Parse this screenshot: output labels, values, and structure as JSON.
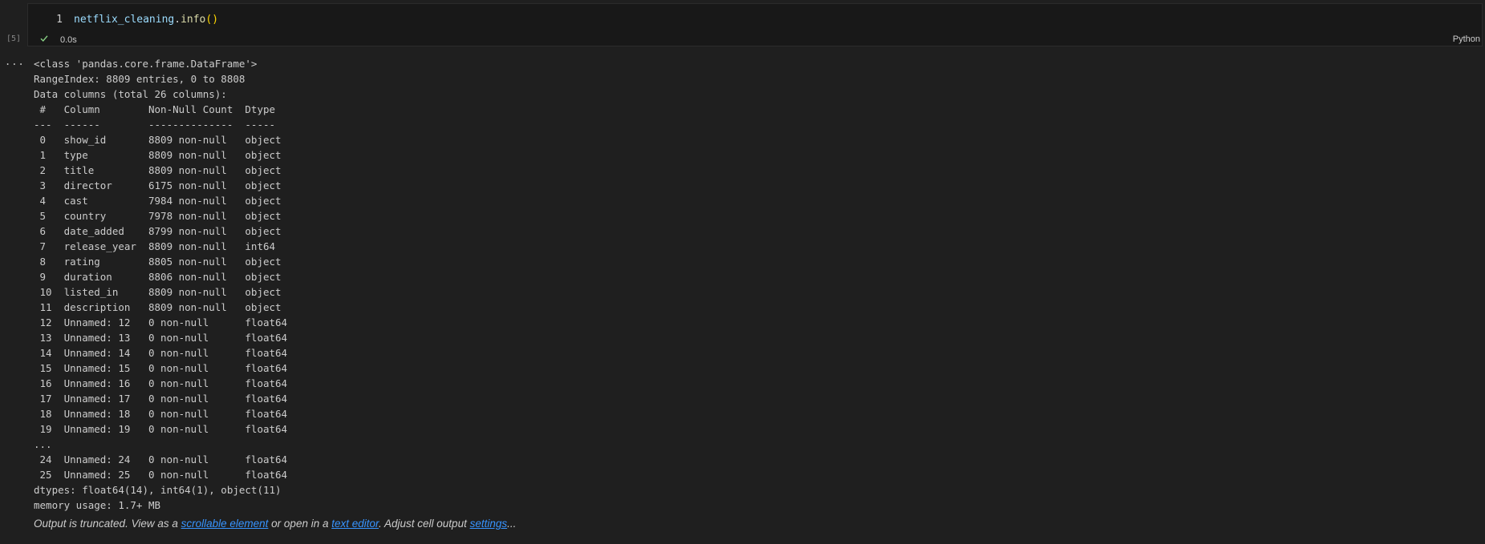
{
  "cell": {
    "execution_count": "[5]",
    "line_number": "1",
    "code": {
      "var": "netflix_cleaning",
      "dot": ".",
      "fn": "info",
      "parens": "()"
    },
    "status_icon": "check-icon",
    "duration": "0.0s",
    "language": "Python"
  },
  "output": {
    "menu_label": "...",
    "lines": [
      "<class 'pandas.core.frame.DataFrame'>",
      "RangeIndex: 8809 entries, 0 to 8808",
      "Data columns (total 26 columns):",
      " #   Column        Non-Null Count  Dtype  ",
      "---  ------        --------------  -----  ",
      " 0   show_id       8809 non-null   object ",
      " 1   type          8809 non-null   object ",
      " 2   title         8809 non-null   object ",
      " 3   director      6175 non-null   object ",
      " 4   cast          7984 non-null   object ",
      " 5   country       7978 non-null   object ",
      " 6   date_added    8799 non-null   object ",
      " 7   release_year  8809 non-null   int64  ",
      " 8   rating        8805 non-null   object ",
      " 9   duration      8806 non-null   object ",
      " 10  listed_in     8809 non-null   object ",
      " 11  description   8809 non-null   object ",
      " 12  Unnamed: 12   0 non-null      float64",
      " 13  Unnamed: 13   0 non-null      float64",
      " 14  Unnamed: 14   0 non-null      float64",
      " 15  Unnamed: 15   0 non-null      float64",
      " 16  Unnamed: 16   0 non-null      float64",
      " 17  Unnamed: 17   0 non-null      float64",
      " 18  Unnamed: 18   0 non-null      float64",
      " 19  Unnamed: 19   0 non-null      float64",
      "...",
      " 24  Unnamed: 24   0 non-null      float64",
      " 25  Unnamed: 25   0 non-null      float64",
      "dtypes: float64(14), int64(1), object(11)",
      "memory usage: 1.7+ MB"
    ],
    "truncation": {
      "prefix": "Output is truncated. View as a ",
      "link1": "scrollable element",
      "middle": " or open in a ",
      "link2": "text editor",
      "middle2": ". Adjust cell output ",
      "link3": "settings",
      "suffix": "..."
    }
  },
  "colors": {
    "background": "#1f1f1f",
    "cell_background": "#181818",
    "link": "#3794ff",
    "success": "#89d185"
  }
}
